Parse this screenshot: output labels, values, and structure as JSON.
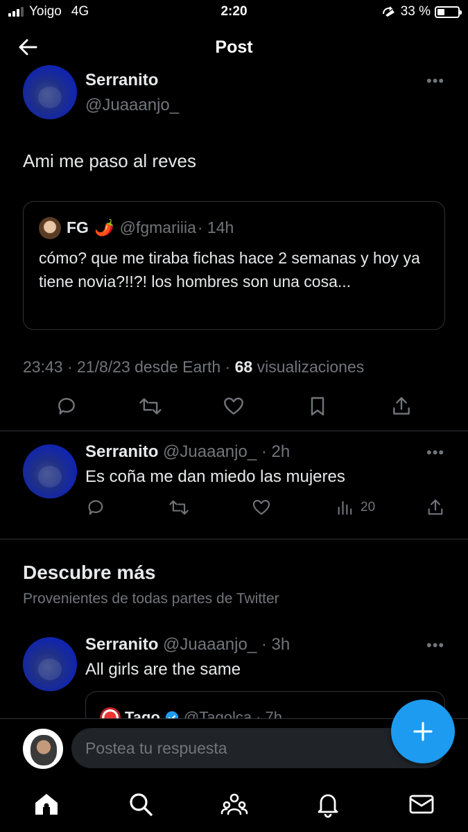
{
  "status_bar": {
    "carrier": "Yoigo",
    "network": "4G",
    "time": "2:20",
    "battery": "33 %"
  },
  "header": {
    "title": "Post"
  },
  "main_post": {
    "name": "Serranito",
    "handle": "@Juaaanjo_",
    "text": "Ami me paso al reves",
    "quoted": {
      "name": "FG",
      "emoji": "🌶️",
      "handle": "@fgmariiia",
      "time": "· 14h",
      "text": "cómo? que me tiraba fichas hace 2 semanas y hoy ya tiene novia?!!?! los hombres son una cosa..."
    },
    "meta": {
      "info": "23:43 · 21/8/23 desde Earth · ",
      "views_count": "68",
      "views_label": " visualizaciones"
    }
  },
  "reply": {
    "name": "Serranito",
    "handle": "@Juaaanjo_",
    "time": "· 2h",
    "text": "Es coña me dan miedo las mujeres",
    "views": "20"
  },
  "discover": {
    "title": "Descubre más",
    "subtitle": "Provenientes de todas partes de Twitter"
  },
  "discover_post": {
    "name": "Serranito",
    "handle": "@Juaaanjo_",
    "time": "· 3h",
    "text": "All girls are the same",
    "quoted_preview": {
      "name": "Tago",
      "handle": "@Tagolca",
      "time": "· 7h"
    }
  },
  "composer": {
    "placeholder": "Postea tu respuesta"
  },
  "tabs": [
    "home-icon",
    "search-icon",
    "communities-icon",
    "notifications-icon",
    "messages-icon"
  ],
  "colors": {
    "accent": "#1d9bf0",
    "background": "#000000",
    "muted": "#71767b",
    "border": "#2f3336"
  }
}
